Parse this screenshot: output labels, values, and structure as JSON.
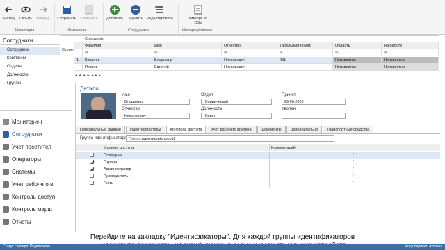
{
  "ribbon": {
    "buttons": [
      {
        "label": "Назад",
        "icon": "back-arrow-icon"
      },
      {
        "label": "Скрыть",
        "icon": "eye-icon"
      },
      {
        "label": "Вперед",
        "icon": "forward-arrow-icon"
      },
      {
        "label": "Сохранить",
        "icon": "save-icon"
      },
      {
        "label": "Отменить",
        "icon": "undo-icon"
      },
      {
        "label": "Добавить",
        "icon": "plus-icon"
      },
      {
        "label": "Удалить",
        "icon": "minus-icon"
      },
      {
        "label": "Редактировать",
        "icon": "edit-list-icon"
      },
      {
        "label": "Импорт из CSV",
        "icon": "import-icon"
      }
    ],
    "groups": [
      "Навигация",
      "Изменения",
      "Сотрудники",
      "Импортирование"
    ]
  },
  "nav": {
    "title": "Сотрудники",
    "items": [
      "Сотрудники",
      "Компании",
      "Отделы",
      "Должности",
      "Группы"
    ],
    "modules": [
      "Мониторинг",
      "Сотрудники",
      "Учет посетител",
      "Операторы",
      "Системы",
      "Учет рабочего в",
      "Контроль доступ",
      "Контроль марш",
      "Отчеты"
    ]
  },
  "grid": {
    "group_label": "Сотрудник",
    "struct_label": "Структ",
    "columns": [
      "Фамилия",
      "Имя",
      "Отчество",
      "Табельный номер",
      "Область",
      "На работе"
    ],
    "rows": [
      {
        "num": "1",
        "cells": [
          "Ковалев",
          "Владимир",
          "Николаевич",
          "031",
          "Неизвестно",
          "Неизвестно"
        ]
      },
      {
        "num": "",
        "cells": [
          "Петров",
          "Евгений",
          "Николаевич",
          "",
          "Неизвестно",
          "Неизвестно"
        ]
      }
    ]
  },
  "details": {
    "title": "Детали",
    "name_label": "Имя",
    "name_value": "Владимир",
    "patronymic_label": "Отчество",
    "patronymic_value": "Николаевич",
    "dept_label": "Отдел",
    "dept_value": "Юридический",
    "position_label": "Должность",
    "position_value": "Юрист",
    "hired_label": "Принят",
    "hired_value": "29.06.2020",
    "fired_label": "Уволен",
    "fired_value": "",
    "tabs": [
      "Персональные данные",
      "Идентификаторы",
      "Контроль доступа",
      "Учет рабочего времени",
      "Документы",
      "Дополнительно",
      "Транспортные средства"
    ],
    "active_tab": 2,
    "idgroup_label": "Группа идентификаторов",
    "idgroup_value": "Группа идентификаторов2",
    "access_col": "Уровень доступа",
    "comment_col": "Комментарий",
    "levels": [
      {
        "name": "Сотрудник",
        "checked": false,
        "selected": true
      },
      {
        "name": "Охрана",
        "checked": true,
        "selected": false
      },
      {
        "name": "Администратор",
        "checked": true,
        "selected": false
      },
      {
        "name": "Руководитель",
        "checked": false,
        "selected": false
      },
      {
        "name": "Гость",
        "checked": false,
        "selected": false
      }
    ]
  },
  "subtitle": {
    "line1": "Перейдите на закладку \"Идентификаторы\". Для каждой группы идентификаторов",
    "line2": "установите  параметры идентификации  в зависимости от  наличия   устройств"
  },
  "status": {
    "left": "Статус сервера: Подключено",
    "right": "Код подписки: Активна"
  },
  "colors": {
    "accent": "#3a6ea5",
    "selected_row": "#dde8f5"
  }
}
